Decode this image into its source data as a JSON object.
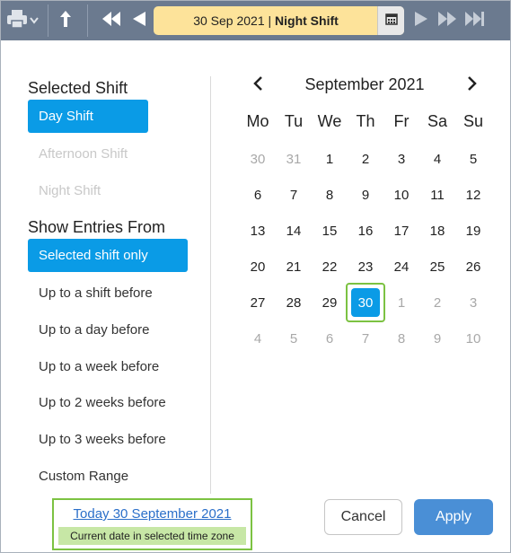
{
  "toolbar": {
    "date_part": "30 Sep 2021",
    "separator": " | ",
    "shift_part": "Night Shift",
    "icons": [
      "print-icon",
      "dropdown-chevron-icon",
      "upload-arrow-icon",
      "fast-rewind-icon",
      "previous-icon",
      "calendar-icon",
      "next-icon",
      "fast-forward-icon",
      "skip-to-end-icon"
    ]
  },
  "selected_shift": {
    "title": "Selected Shift",
    "options": [
      {
        "label": "Day Shift",
        "state": "selected"
      },
      {
        "label": "Afternoon Shift",
        "state": "disabled"
      },
      {
        "label": "Night Shift",
        "state": "disabled"
      }
    ]
  },
  "show_entries": {
    "title": "Show Entries From",
    "options": [
      {
        "label": "Selected shift only",
        "state": "selected"
      },
      {
        "label": "Up to a shift before",
        "state": "normal"
      },
      {
        "label": "Up to a day before",
        "state": "normal"
      },
      {
        "label": "Up to a week before",
        "state": "normal"
      },
      {
        "label": "Up to 2 weeks before",
        "state": "normal"
      },
      {
        "label": "Up to 3 weeks before",
        "state": "normal"
      },
      {
        "label": "Custom Range",
        "state": "normal"
      }
    ]
  },
  "calendar": {
    "month_title": "September 2021",
    "weekdays": [
      "Mo",
      "Tu",
      "We",
      "Th",
      "Fr",
      "Sa",
      "Su"
    ],
    "weeks": [
      [
        {
          "d": "30",
          "o": true
        },
        {
          "d": "31",
          "o": true
        },
        {
          "d": "1"
        },
        {
          "d": "2"
        },
        {
          "d": "3"
        },
        {
          "d": "4"
        },
        {
          "d": "5"
        }
      ],
      [
        {
          "d": "6"
        },
        {
          "d": "7"
        },
        {
          "d": "8"
        },
        {
          "d": "9"
        },
        {
          "d": "10"
        },
        {
          "d": "11"
        },
        {
          "d": "12"
        }
      ],
      [
        {
          "d": "13"
        },
        {
          "d": "14"
        },
        {
          "d": "15"
        },
        {
          "d": "16"
        },
        {
          "d": "17"
        },
        {
          "d": "18"
        },
        {
          "d": "19"
        }
      ],
      [
        {
          "d": "20"
        },
        {
          "d": "21"
        },
        {
          "d": "22"
        },
        {
          "d": "23"
        },
        {
          "d": "24"
        },
        {
          "d": "25"
        },
        {
          "d": "26"
        }
      ],
      [
        {
          "d": "27"
        },
        {
          "d": "28"
        },
        {
          "d": "29"
        },
        {
          "d": "30",
          "s": true
        },
        {
          "d": "1",
          "o": true
        },
        {
          "d": "2",
          "o": true
        },
        {
          "d": "3",
          "o": true
        }
      ],
      [
        {
          "d": "4",
          "o": true
        },
        {
          "d": "5",
          "o": true
        },
        {
          "d": "6",
          "o": true
        },
        {
          "d": "7",
          "o": true
        },
        {
          "d": "8",
          "o": true
        },
        {
          "d": "9",
          "o": true
        },
        {
          "d": "10",
          "o": true
        }
      ]
    ]
  },
  "footer": {
    "today_link": "Today 30 September 2021",
    "today_note": "Current date in selected time zone",
    "cancel_label": "Cancel",
    "apply_label": "Apply"
  },
  "colors": {
    "toolbar_bg": "#6b7a8f",
    "date_box_bg": "#fde39a",
    "selected_blue": "#0a9be6",
    "apply_blue": "#4a8fd6",
    "highlight_green": "#7cc242",
    "note_green": "#c7e7a6"
  }
}
